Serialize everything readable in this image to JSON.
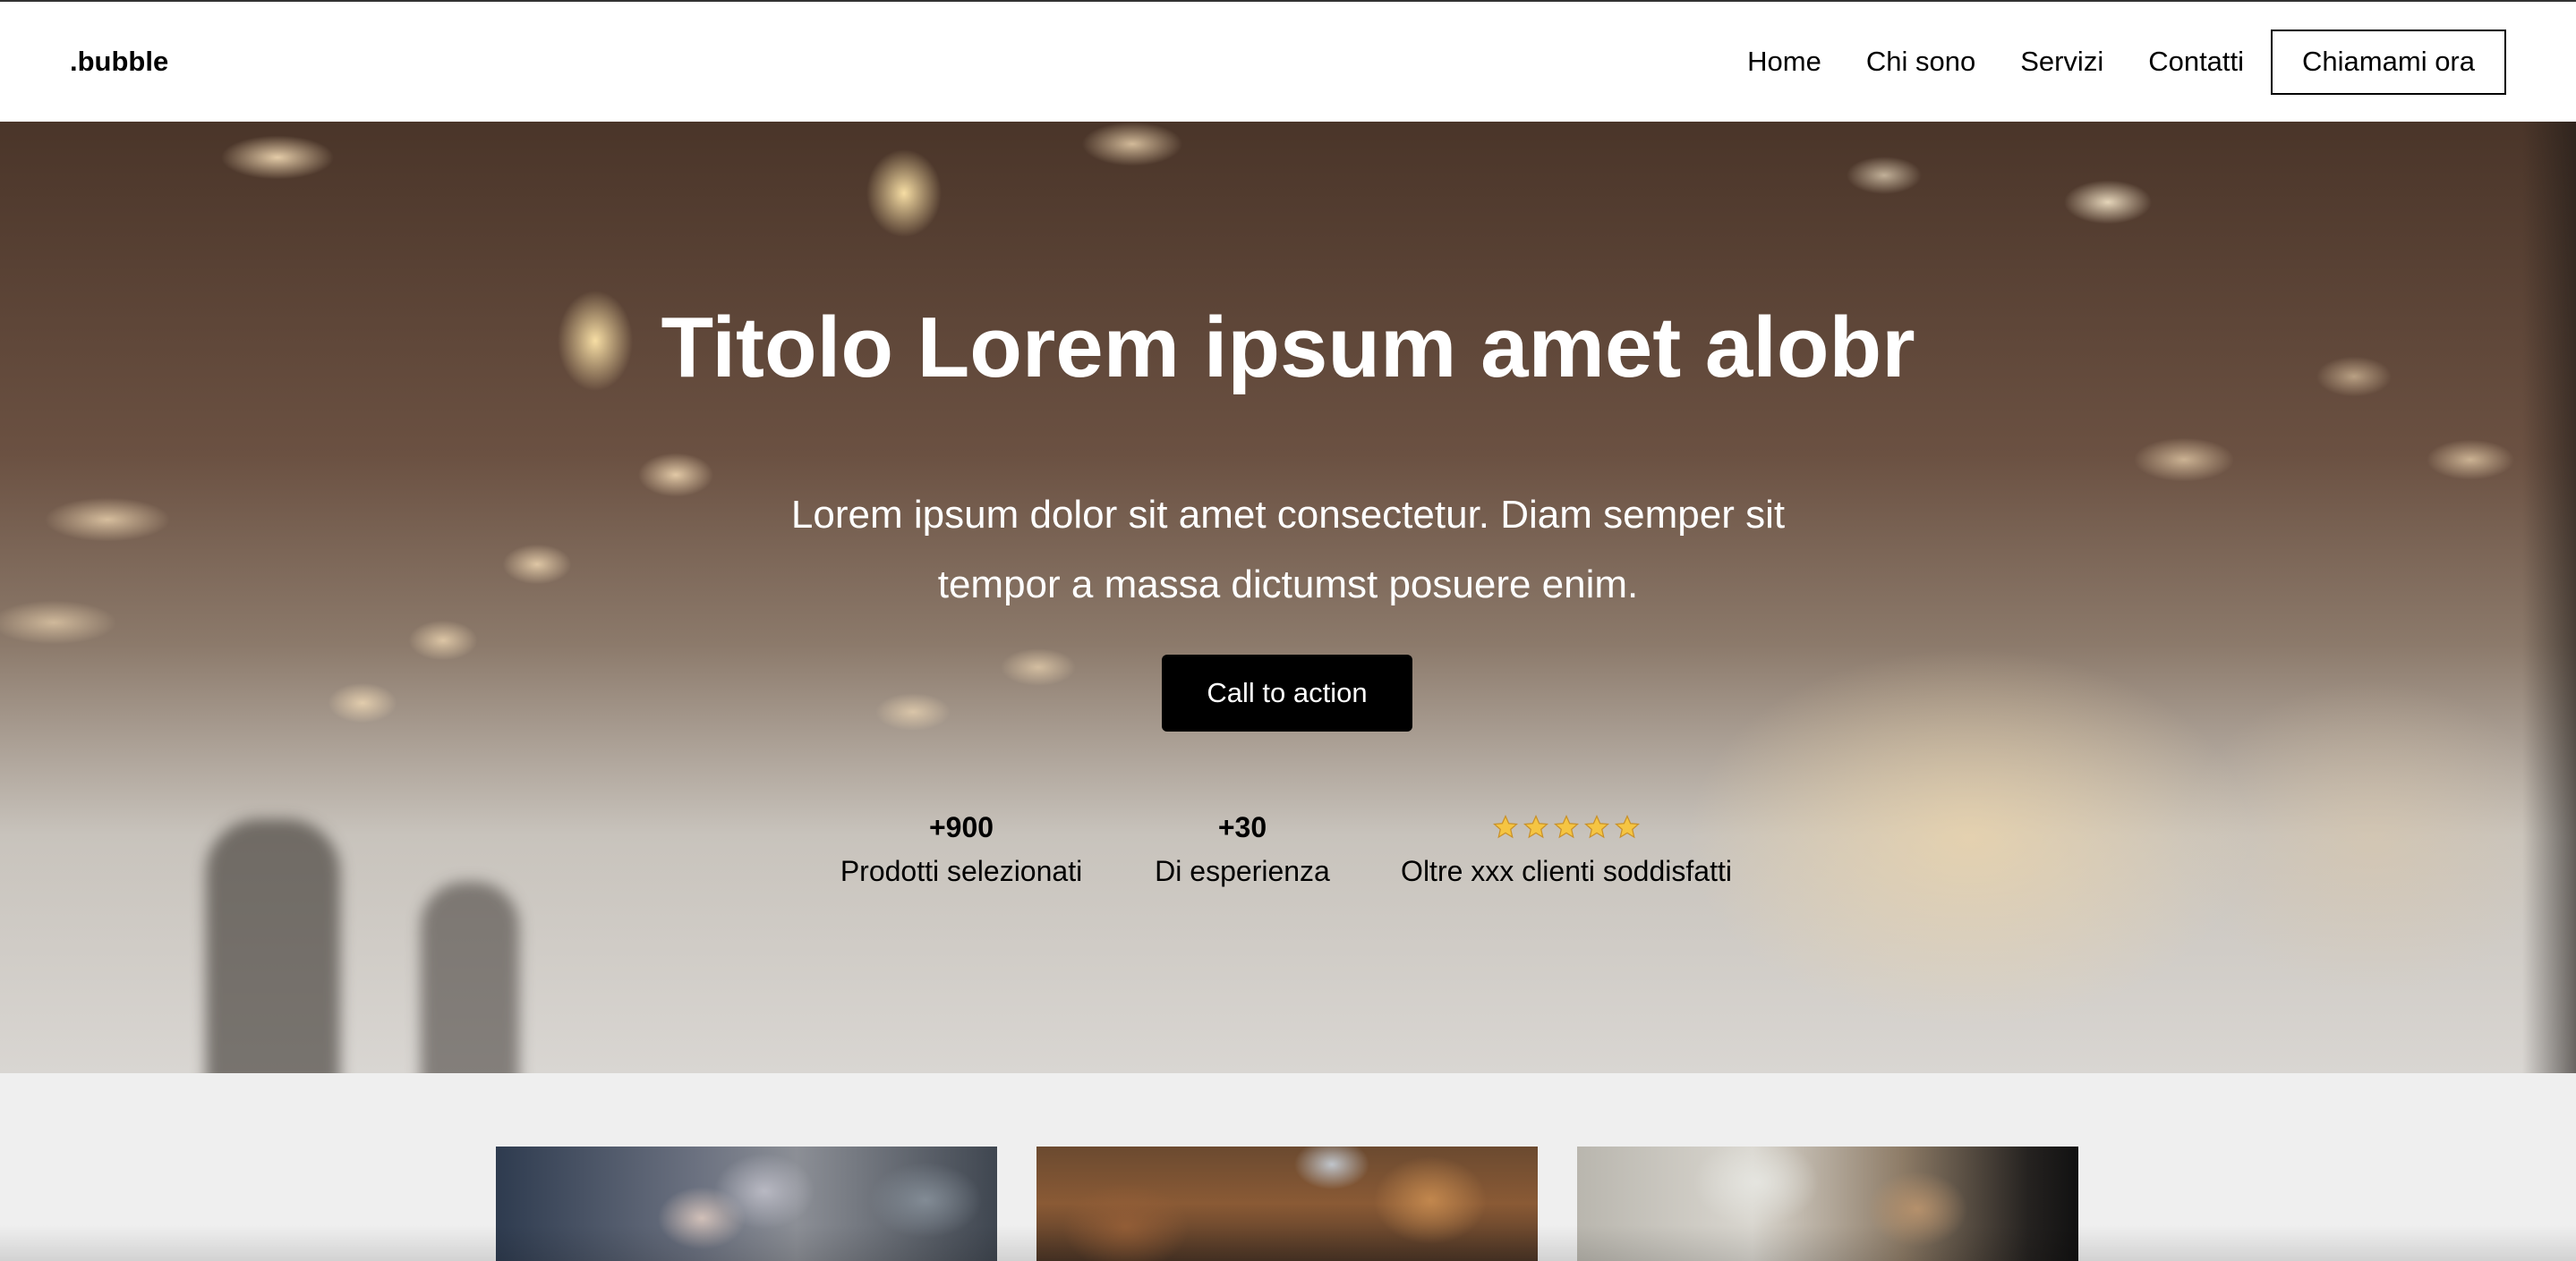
{
  "navbar": {
    "logo": ".bubble",
    "links": [
      {
        "label": "Home"
      },
      {
        "label": "Chi sono"
      },
      {
        "label": "Servizi"
      },
      {
        "label": "Contatti"
      }
    ],
    "cta_label": "Chiamami ora"
  },
  "hero": {
    "title": "Titolo Lorem ipsum amet alobr",
    "subtitle": "Lorem ipsum dolor sit amet consectetur. Diam semper sit tempor a massa dictumst posuere enim.",
    "button_label": "Call to action",
    "stats": [
      {
        "value": "+900",
        "label": "Prodotti selezionati"
      },
      {
        "value": "+30",
        "label": "Di esperienza"
      },
      {
        "rating_stars": 5,
        "label": "Oltre xxx clienti soddisfatti"
      }
    ]
  },
  "colors": {
    "nav_background": "#ffffff",
    "button_background": "#000000",
    "section_background": "#efefef",
    "star_color": "#f5c542"
  },
  "cards": [
    {
      "image": "people-sitting-photo"
    },
    {
      "image": "office-meeting-photo"
    },
    {
      "image": "office-interior-photo"
    }
  ]
}
